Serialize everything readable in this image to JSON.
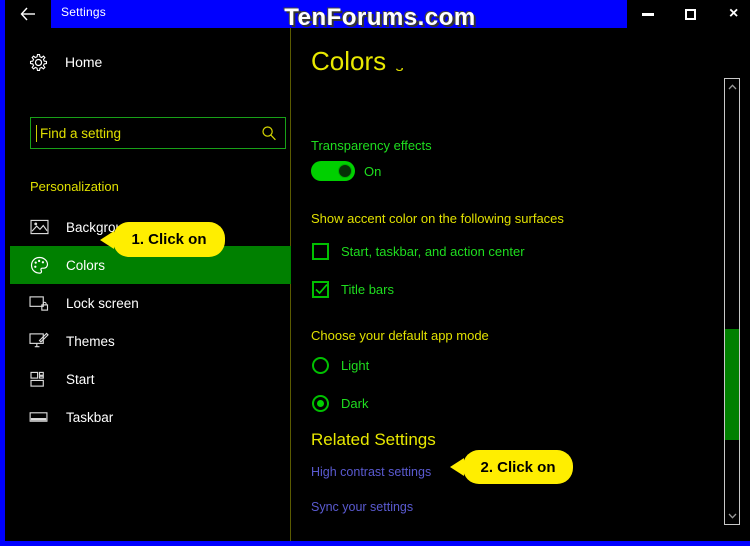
{
  "watermark": "TenForums.com",
  "titlebar": {
    "title": "Settings",
    "back_icon": "back-arrow-icon",
    "minimize_label": "Minimize",
    "maximize_label": "Maximize",
    "close_label": "×"
  },
  "sidebar": {
    "home_label": "Home",
    "home_icon": "gear-icon",
    "search": {
      "value": "",
      "placeholder": "Find a setting",
      "icon": "search-icon"
    },
    "group_label": "Personalization",
    "items": [
      {
        "label": "Background",
        "icon": "picture-icon",
        "selected": false
      },
      {
        "label": "Colors",
        "icon": "palette-icon",
        "selected": true
      },
      {
        "label": "Lock screen",
        "icon": "lock-screen-icon",
        "selected": false
      },
      {
        "label": "Themes",
        "icon": "themes-icon",
        "selected": false
      },
      {
        "label": "Start",
        "icon": "start-tiles-icon",
        "selected": false
      },
      {
        "label": "Taskbar",
        "icon": "taskbar-icon",
        "selected": false
      }
    ]
  },
  "main": {
    "page_title": "Colors",
    "clipped_heading": "more options",
    "transparency": {
      "label": "Transparency effects",
      "state": "On"
    },
    "accent_surfaces": {
      "heading": "Show accent color on the following surfaces",
      "options": [
        {
          "label": "Start, taskbar, and action center",
          "checked": false
        },
        {
          "label": "Title bars",
          "checked": true
        }
      ]
    },
    "app_mode": {
      "heading": "Choose your default app mode",
      "options": [
        {
          "label": "Light",
          "selected": false
        },
        {
          "label": "Dark",
          "selected": true
        }
      ]
    },
    "related": {
      "heading": "Related Settings",
      "links": [
        "High contrast settings",
        "Sync your settings"
      ]
    },
    "scrollbar": {
      "up_icon": "chevron-up-icon",
      "down_icon": "chevron-down-icon"
    }
  },
  "callouts": [
    {
      "text": "1. Click on"
    },
    {
      "text": "2. Click on"
    }
  ],
  "colors": {
    "titlebar_blue": "#0000ff",
    "accent_green": "#008000",
    "text_green": "#1fdd1f",
    "heading_yellow": "#e0e000",
    "link_blue": "#5a5ad0",
    "callout_yellow": "#ffee00"
  }
}
